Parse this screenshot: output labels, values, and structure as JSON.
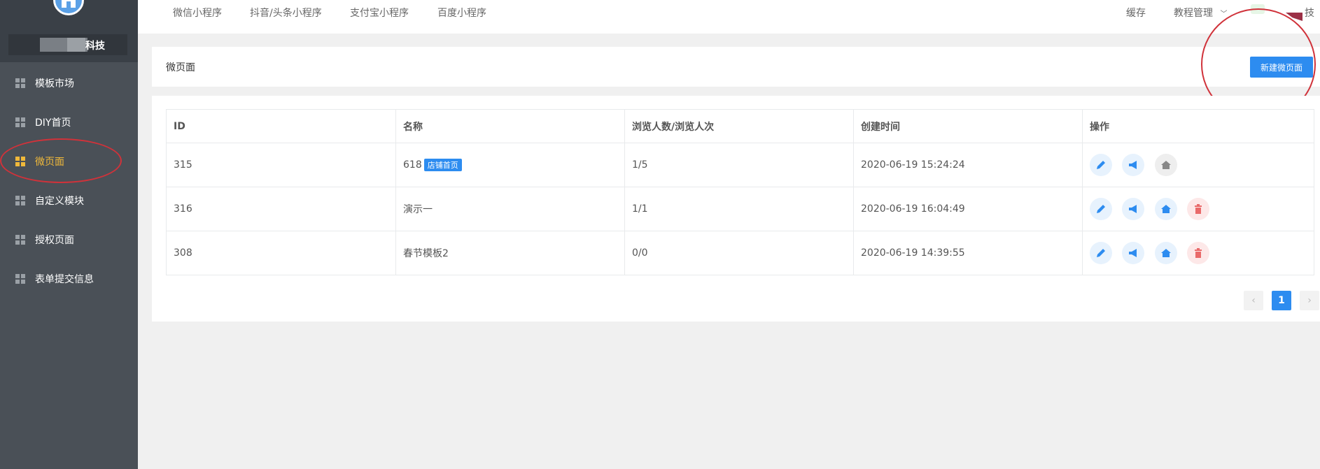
{
  "sidebar": {
    "company_suffix": "科技",
    "items": [
      {
        "label": "模板市场",
        "active": false
      },
      {
        "label": "DIY首页",
        "active": false
      },
      {
        "label": "微页面",
        "active": true
      },
      {
        "label": "自定义模块",
        "active": false
      },
      {
        "label": "授权页面",
        "active": false
      },
      {
        "label": "表单提交信息",
        "active": false
      }
    ]
  },
  "topnav": {
    "tabs": [
      "微信小程序",
      "抖音/头条小程序",
      "支付宝小程序",
      "百度小程序"
    ],
    "cache": "缓存",
    "tutorial": "教程管理",
    "user_suffix": "技"
  },
  "header": {
    "title": "微页面",
    "new_button": "新建微页面"
  },
  "table": {
    "columns": [
      "ID",
      "名称",
      "浏览人数/浏览人次",
      "创建时间",
      "操作"
    ],
    "rows": [
      {
        "id": "315",
        "name": "618",
        "badge": "店铺首页",
        "views": "1/5",
        "created": "2020-06-19 15:24:24",
        "home_set": true,
        "deletable": false
      },
      {
        "id": "316",
        "name": "演示一",
        "badge": "",
        "views": "1/1",
        "created": "2020-06-19 16:04:49",
        "home_set": false,
        "deletable": true
      },
      {
        "id": "308",
        "name": "春节模板2",
        "badge": "",
        "views": "0/0",
        "created": "2020-06-19 14:39:55",
        "home_set": false,
        "deletable": true
      }
    ]
  },
  "pagination": {
    "prev": "‹",
    "current": "1",
    "next": "›"
  },
  "colors": {
    "accent": "#2d8cf0",
    "active_menu": "#f0b93a",
    "annotation": "#d0323a"
  }
}
